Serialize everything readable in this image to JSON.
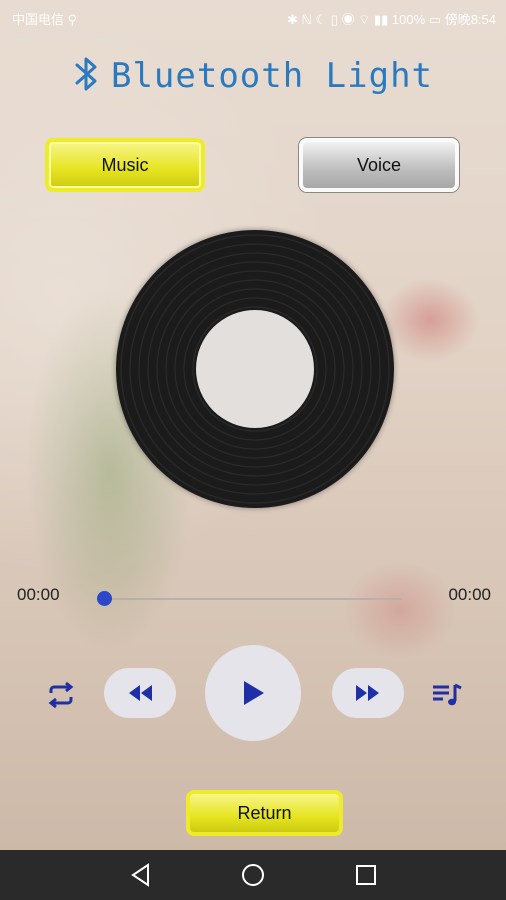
{
  "statusbar": {
    "carrier": "中国电信 ⚲",
    "right": "✱ ℕ ☾ ▯ ◉ ⌔ ▮▮ 100% ▭ 傍晚8:54"
  },
  "header": {
    "title": "Bluetooth Light",
    "icon": "bluetooth-icon"
  },
  "modes": {
    "music_label": "Music",
    "voice_label": "Voice",
    "selected": "Music"
  },
  "player": {
    "time_elapsed": "00:00",
    "time_total": "00:00",
    "progress": 0
  },
  "controls": {
    "repeat_icon": "repeat-icon",
    "prev_icon": "rewind-icon",
    "play_icon": "play-icon",
    "next_icon": "fast-forward-icon",
    "playlist_icon": "playlist-icon"
  },
  "footer": {
    "return_label": "Return"
  },
  "colors": {
    "accent_blue": "#2a7ac0",
    "control_icon": "#1e2fa8",
    "button_yellow": "#e6e420"
  }
}
